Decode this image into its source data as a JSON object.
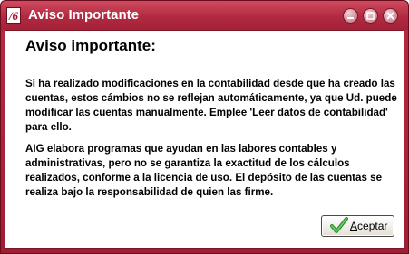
{
  "window": {
    "title": "Aviso Importante",
    "app_icon_glyph": "/6",
    "controls": {
      "minimize": "minimize-icon",
      "maximize": "maximize-icon",
      "close": "close-icon"
    }
  },
  "dialog": {
    "heading": "Aviso importante:",
    "paragraph1": "Si ha realizado modificaciones en la contabilidad desde que ha creado las cuentas, estos cámbios no se reflejan automáticamente, ya que Ud. puede modificar las cuentas manualmente. Emplee 'Leer datos de contabilidad' para ello.",
    "paragraph2": "AIG elabora programas que ayudan en las labores contables y administrativas, pero no se garantiza la exactitud de los cálculos realizados, conforme a la licencia de uso. El depósito de las cuentas se realiza bajo la responsabilidad de quien las firme.",
    "accept_button": {
      "mnemonic": "A",
      "rest": "ceptar",
      "icon": "checkmark-icon"
    }
  },
  "colors": {
    "titlebar": "#b02a40",
    "border": "#7c1627",
    "check_green": "#3aa83a"
  }
}
